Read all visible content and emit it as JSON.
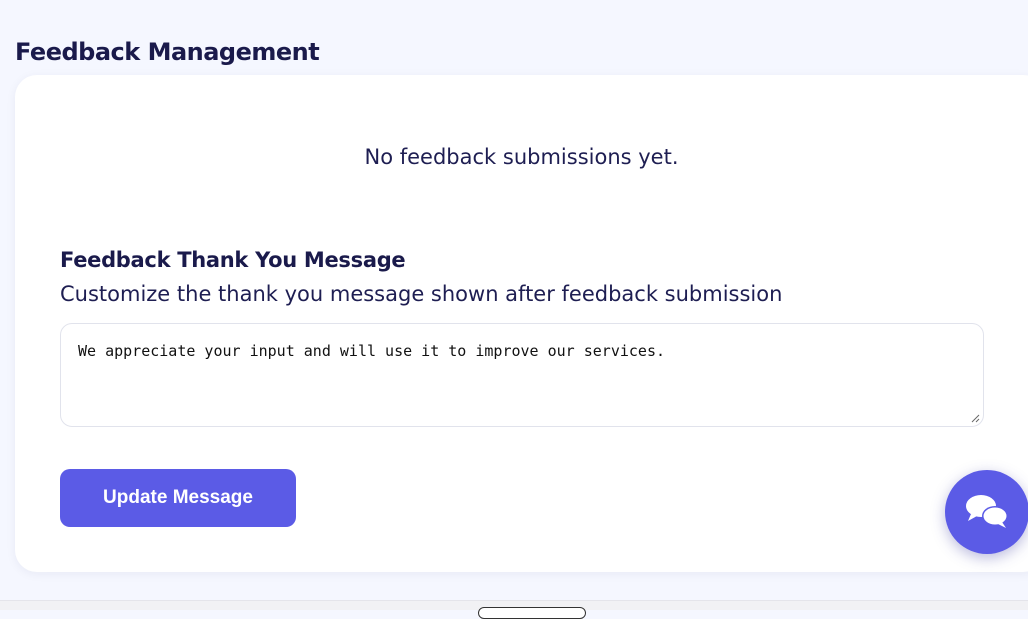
{
  "page": {
    "title": "Feedback Management"
  },
  "feedback": {
    "empty_message": "No feedback submissions yet."
  },
  "thank_you": {
    "heading": "Feedback Thank You Message",
    "description": "Customize the thank you message shown after feedback submission",
    "message_value": "We appreciate your input and will use it to improve our services.",
    "update_label": "Update Message"
  },
  "chat": {
    "icon": "chat-bubbles-icon"
  },
  "colors": {
    "accent": "#5b5be6",
    "text_dark": "#1a1a4b",
    "background": "#f5f7ff"
  }
}
